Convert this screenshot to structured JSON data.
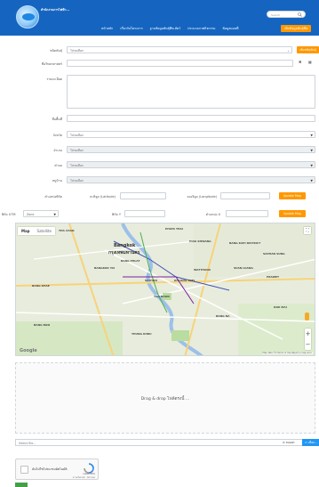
{
  "header": {
    "logo_text": "สำนักงานการไฟฟ้า...",
    "search_placeholder": "Search",
    "nav": [
      {
        "label": "หน้าหลัก"
      },
      {
        "label": "เกี่ยวกับโครงการ"
      },
      {
        "label": "ฐานข้อมูลพันธุ์พืช-สัตว์"
      },
      {
        "label": "ประมวลภาพกิจกรรม"
      },
      {
        "label": "ข้อมูลแผนที่"
      },
      {
        "label": "เพิ่มข้อมูลพันธุ์พืช"
      }
    ]
  },
  "form": {
    "type_label": "ชนิดพันธุ์",
    "type_value": "โปรดเลือก",
    "add_type_button": "เพิ่มชนิดพันธุ์",
    "sci_label": "ชื่อวิทยาศาสตร์",
    "desc_label": "รายละเอียด",
    "place_label": "ชื่อพื้นที่",
    "province_label": "จังหวัด",
    "province_value": "โปรดเลือก",
    "district_label": "อำเภอ",
    "district_value": "โปรดเลือก",
    "subdistrict_label": "ตำบล",
    "subdistrict_value": "โปรดเลือก",
    "village_label": "หมู่บ้าน",
    "village_value": "โปรดเลือก",
    "coord_label": "ตำแหน่งพิกัด",
    "lat_label": "ละติจูด (Latitude)",
    "lng_label": "ลองจิจูด (Longitude)",
    "update_map_1": "Update Map",
    "utm_label": "พิกัด UTM",
    "zone_label": "Zone",
    "zone_value": "Zone",
    "north_label": "พิกัด Y",
    "east_label": "ตำแหน่ง X",
    "update_map_2": "Update Map"
  },
  "map": {
    "tab_map": "Map",
    "tab_satellite": "Satellite",
    "labels": [
      "PHAYA THAI",
      "HUAI KHWANG",
      "BANG KAPI DISTRICT",
      "SAPHAN SUNG",
      "BANG PHLAT",
      "WATTHANA",
      "SUAN LUANG",
      "PRAWET",
      "SATHON",
      "KHLONG TOEI",
      "YAN NAWA",
      "BANG NA",
      "THUNG KHRU",
      "BANG KHAE",
      "BANG BON",
      "DOK MAI",
      "THA CHAN",
      "BANGKOK YAI"
    ],
    "city_th": "กรุงเทพมหานคร",
    "city_en": "Bangkok",
    "zoom_in": "+",
    "zoom_out": "−",
    "google": "Google",
    "attribution": "Map data ©2 Terms of Use Report a map error"
  },
  "upload": {
    "drop_text": "Drag & drop ไฟล์ตรงนี้ …",
    "file_placeholder": "Select file...",
    "clear_label": "⊘ ลบออก",
    "browse_label": "เลือก..."
  },
  "captcha": {
    "label": "ฉันไม่ใช่โปรแกรมอัตโนมัติ",
    "brand": "reCAPTCHA",
    "links": "ความเป็นส่วนตัว - ข้อกำหนด"
  },
  "colors": {
    "header_blue": "#1565c0",
    "accent_orange": "#ff9800",
    "browse_blue": "#2196f3"
  }
}
